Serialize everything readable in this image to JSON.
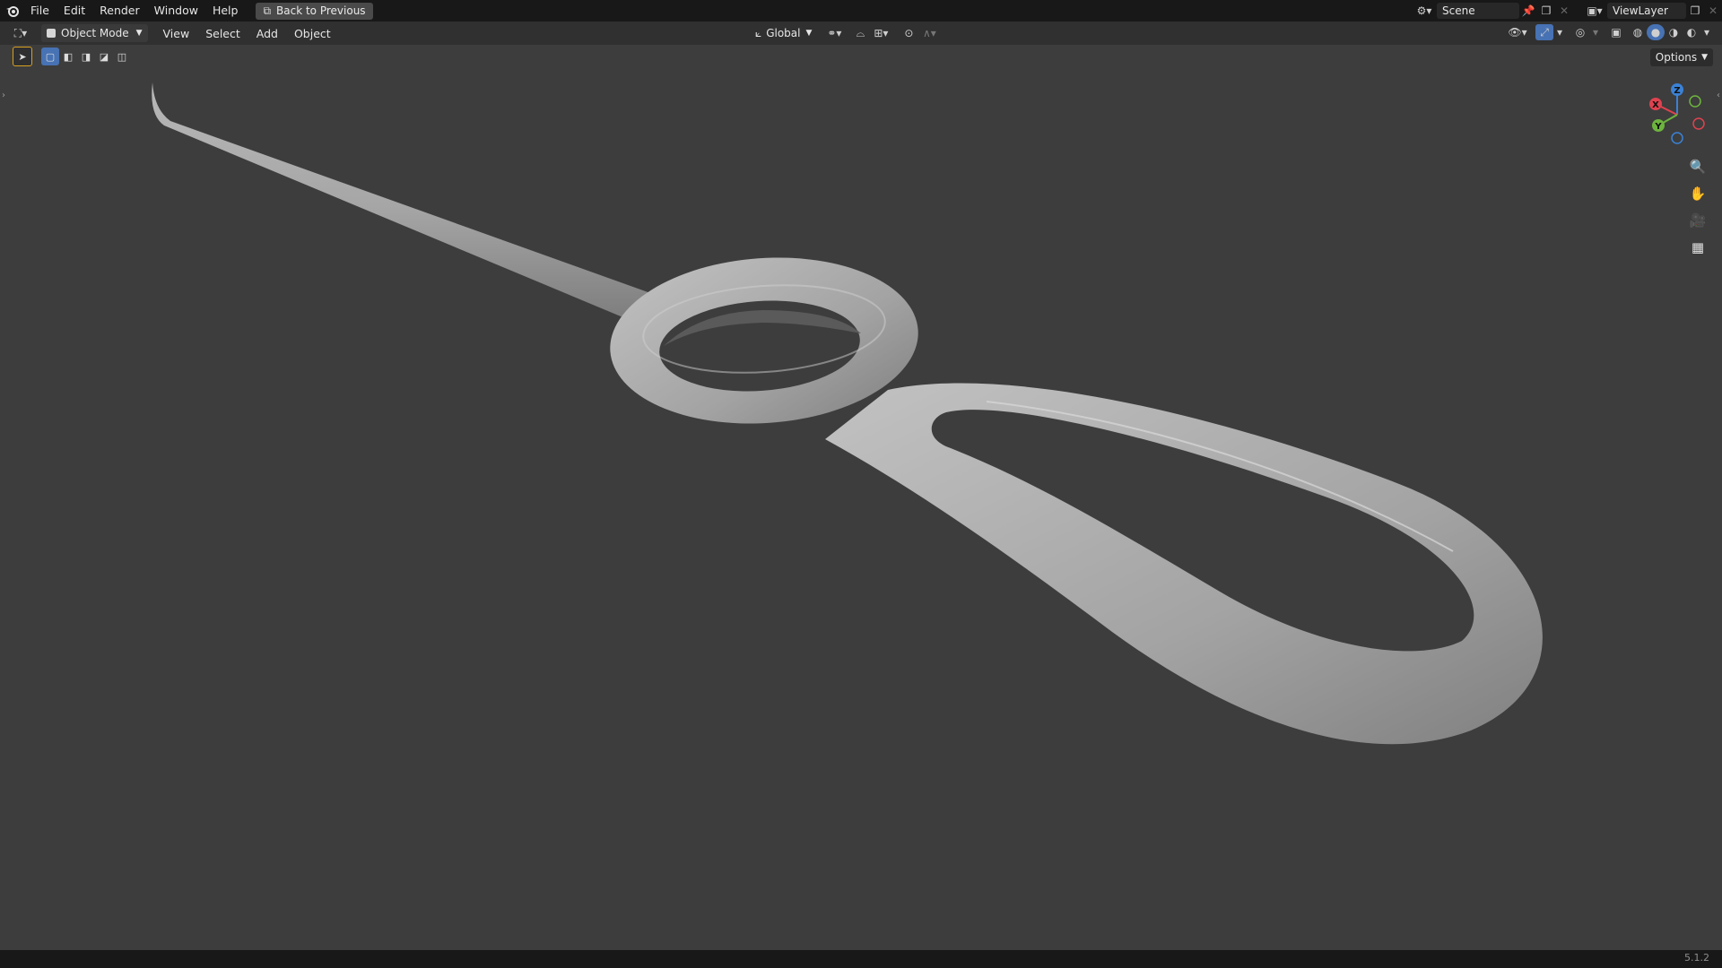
{
  "app": {
    "version": "5.1.2"
  },
  "topbar": {
    "menus": [
      "File",
      "Edit",
      "Render",
      "Window",
      "Help"
    ],
    "back_label": "Back to Previous",
    "scene_label": "Scene",
    "view_layer_label": "ViewLayer"
  },
  "header": {
    "mode_label": "Object Mode",
    "menus": [
      "View",
      "Select",
      "Add",
      "Object"
    ],
    "orientation_label": "Global",
    "options_label": "Options"
  },
  "gizmo": {
    "z": "Z",
    "y": "Y",
    "x": "X"
  },
  "colors": {
    "x_axis": "#e0424f",
    "y_axis": "#6db43e",
    "z_axis": "#3b82d6",
    "accent": "#4772b3"
  }
}
